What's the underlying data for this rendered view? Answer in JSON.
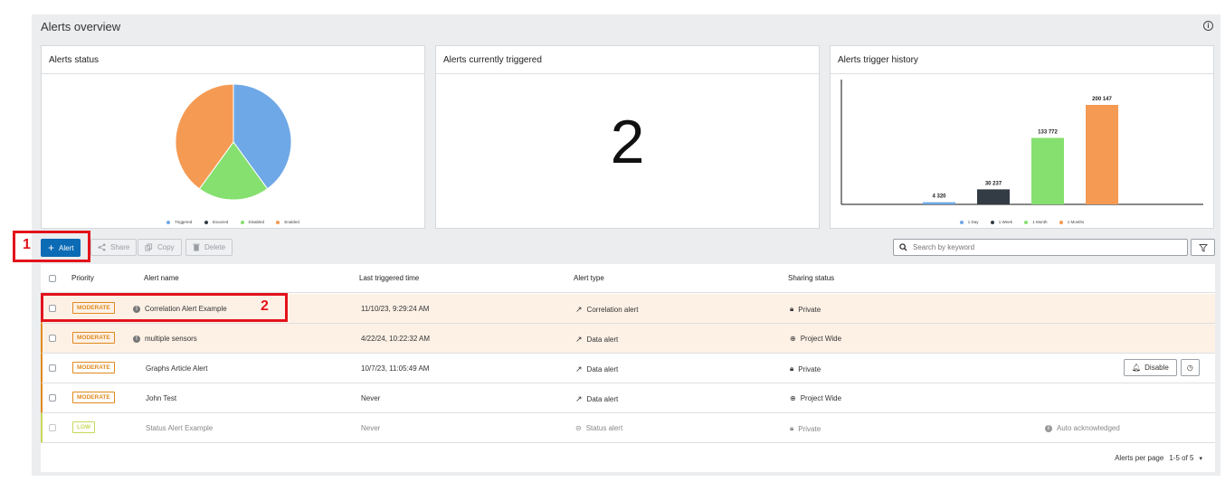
{
  "panel": {
    "title": "Alerts overview"
  },
  "cards": {
    "status": {
      "title": "Alerts status",
      "legend": [
        {
          "label": "Triggered",
          "color": "#6fa8e6"
        },
        {
          "label": "Snoozed",
          "color": "#333b45"
        },
        {
          "label": "Disabled",
          "color": "#86e06f"
        },
        {
          "label": "Enabled",
          "color": "#f59a53"
        }
      ]
    },
    "triggered": {
      "title": "Alerts currently triggered",
      "value": "2"
    },
    "history": {
      "title": "Alerts trigger history",
      "legend": [
        {
          "label": "1 Day",
          "color": "#6fa8e6"
        },
        {
          "label": "1 Week",
          "color": "#333b45"
        },
        {
          "label": "1 Month",
          "color": "#86e06f"
        },
        {
          "label": "1 Months",
          "color": "#f59a53"
        }
      ]
    }
  },
  "chart_data": [
    {
      "type": "pie",
      "categories": [
        "Triggered",
        "Snoozed",
        "Disabled",
        "Enabled"
      ],
      "values": [
        40,
        0,
        20,
        40
      ],
      "colors": [
        "#6fa8e6",
        "#333b45",
        "#86e06f",
        "#f59a53"
      ]
    },
    {
      "type": "bar",
      "categories": [
        "1 Day",
        "1 Week",
        "1 Month",
        "1 Months"
      ],
      "values": [
        4320,
        30237,
        133772,
        200147
      ],
      "labels": [
        "4 320",
        "30 237",
        "133 772",
        "200 147"
      ],
      "colors": [
        "#6fa8e6",
        "#333b45",
        "#86e06f",
        "#f59a53"
      ],
      "ylim": [
        0,
        200147
      ],
      "grid": false,
      "legend": "bottom"
    }
  ],
  "toolbar": {
    "add_label": "Alert",
    "share_label": "Share",
    "copy_label": "Copy",
    "delete_label": "Delete",
    "search_placeholder": "Search by keyword"
  },
  "annotations": {
    "one": "1",
    "two": "2"
  },
  "table": {
    "headers": {
      "priority": "Priority",
      "name": "Alert name",
      "last": "Last triggered time",
      "type": "Alert type",
      "sharing": "Sharing status"
    },
    "rows": [
      {
        "priority": "MODERATE",
        "name": "Correlation Alert Example",
        "last": "11/10/23, 9:29:24 AM",
        "type": "Correlation alert",
        "sharing": "Private"
      },
      {
        "priority": "MODERATE",
        "name": "multiple sensors",
        "last": "4/22/24, 10:22:32 AM",
        "type": "Data alert",
        "sharing": "Project Wide"
      },
      {
        "priority": "MODERATE",
        "name": "Graphs Article Alert",
        "last": "10/7/23, 11:05:49 AM",
        "type": "Data alert",
        "sharing": "Private",
        "disable_label": "Disable"
      },
      {
        "priority": "MODERATE",
        "name": "John Test",
        "last": "Never",
        "type": "Data alert",
        "sharing": "Project Wide"
      },
      {
        "priority": "LOW",
        "name": "Status Alert Example",
        "last": "Never",
        "type": "Status alert",
        "sharing": "Private",
        "status_note": "Auto acknowledged"
      }
    ]
  },
  "pagination": {
    "label": "Alerts per page",
    "range": "1-5 of 5"
  },
  "colors": {
    "accent": "#0b6bb5",
    "moderate": "#e08a1e",
    "low": "#c8d85a",
    "highlight_row": "#fdf1e6",
    "annotation": "#e3131b"
  }
}
